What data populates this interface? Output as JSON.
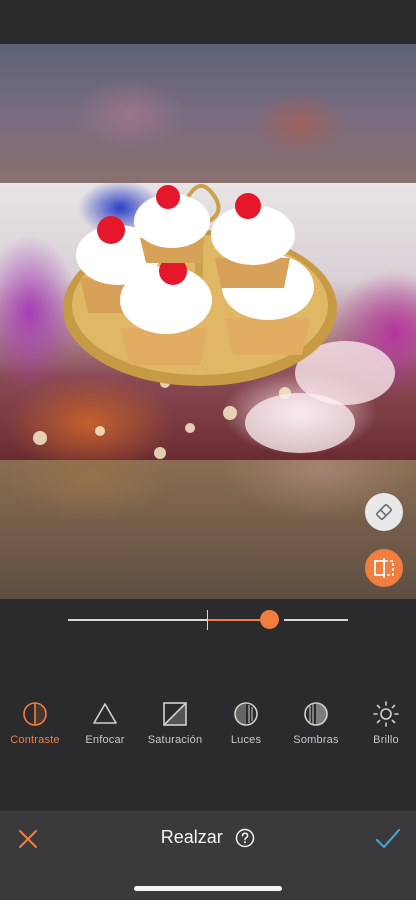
{
  "colors": {
    "accent": "#f07e3f",
    "background": "#2b2b2d",
    "bottom_bar": "#3a3a3c",
    "confirm": "#4aa8d8"
  },
  "slider": {
    "value_fraction": 0.72,
    "center_fraction": 0.5
  },
  "tools": [
    {
      "label": "Contraste",
      "icon": "contrast-icon",
      "active": true
    },
    {
      "label": "Enfocar",
      "icon": "triangle-icon",
      "active": false
    },
    {
      "label": "Saturación",
      "icon": "saturation-icon",
      "active": false
    },
    {
      "label": "Luces",
      "icon": "highlights-icon",
      "active": false
    },
    {
      "label": "Sombras",
      "icon": "shadows-icon",
      "active": false
    },
    {
      "label": "Brillo",
      "icon": "sun-icon",
      "active": false
    }
  ],
  "bottom_bar": {
    "title": "Realzar",
    "help_icon": "help-icon",
    "close_icon": "close-icon",
    "confirm_icon": "check-icon"
  },
  "floating": {
    "eraser_icon": "eraser-icon",
    "compare_icon": "compare-icon"
  }
}
